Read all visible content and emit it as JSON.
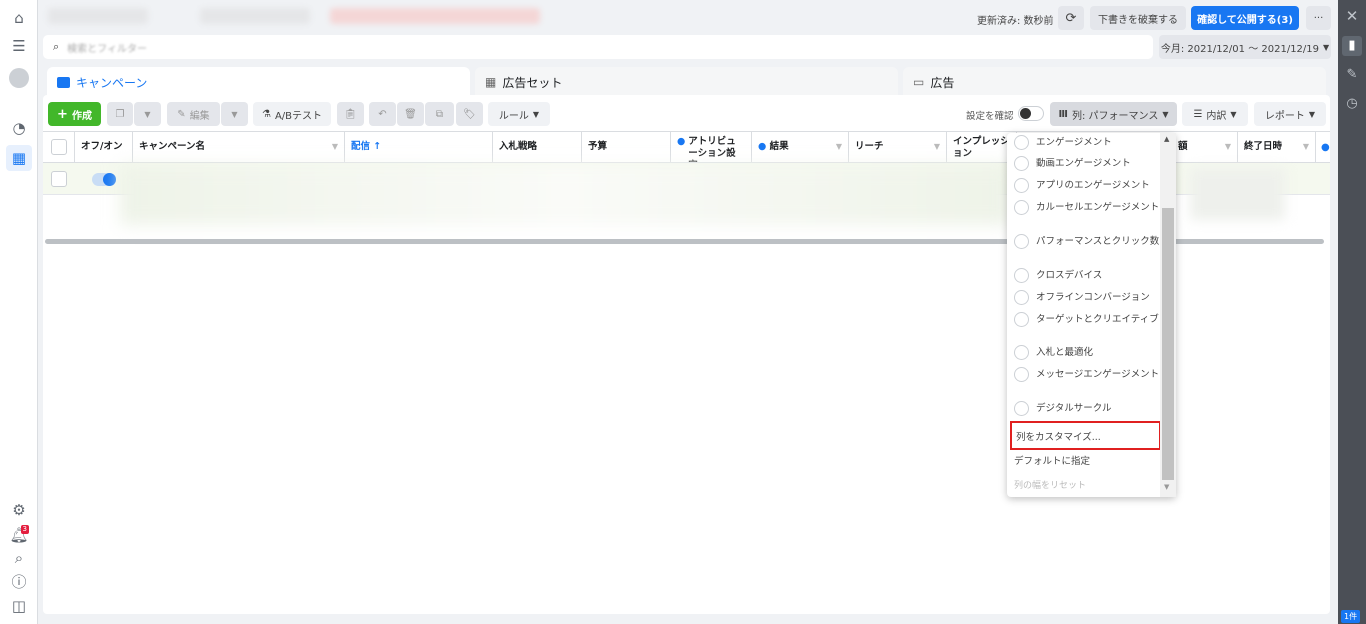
{
  "header": {
    "updated": "更新済み: 数秒前",
    "discard": "下書きを破棄する",
    "publish": "確認して公開する(3)",
    "more": "···",
    "date_range": "今月: 2021/12/01 ～ 2021/12/19",
    "search_placeholder": "検索とフィルター"
  },
  "tabs": [
    {
      "label": "キャンペーン",
      "active": true
    },
    {
      "label": "広告セット"
    },
    {
      "label": "広告"
    }
  ],
  "toolbar": {
    "create": "作成",
    "edit": "編集",
    "ab_test": "A/Bテスト",
    "rules": "ルール",
    "view_settings": "設定を確認",
    "columns": "列: パフォーマンス",
    "breakdown": "内訳",
    "reports": "レポート"
  },
  "table": {
    "headers": [
      "オフ/オン",
      "キャンペーン名",
      "配信 ↑",
      "入札戦略",
      "予算",
      "アトリビューション設定",
      "結果",
      "リーチ",
      "インプレッション",
      "額",
      "終了日時"
    ]
  },
  "column_menu": {
    "items": [
      "エンゲージメント",
      "動画エンゲージメント",
      "アプリのエンゲージメント",
      "カルーセルエンゲージメント",
      "パフォーマンスとクリック数",
      "クロスデバイス",
      "オフラインコンバージョン",
      "ターゲットとクリエイティブ",
      "入札と最適化",
      "メッセージエンゲージメント",
      "デジタルサークル"
    ],
    "customize": "列をカスタマイズ...",
    "set_default": "デフォルトに指定",
    "reset_width": "列の幅をリセット"
  },
  "notifications_count": "3",
  "right_badge": "1件",
  "colors": {
    "accent": "#1877f2",
    "create": "#42b72a",
    "highlight": "#e02020"
  }
}
